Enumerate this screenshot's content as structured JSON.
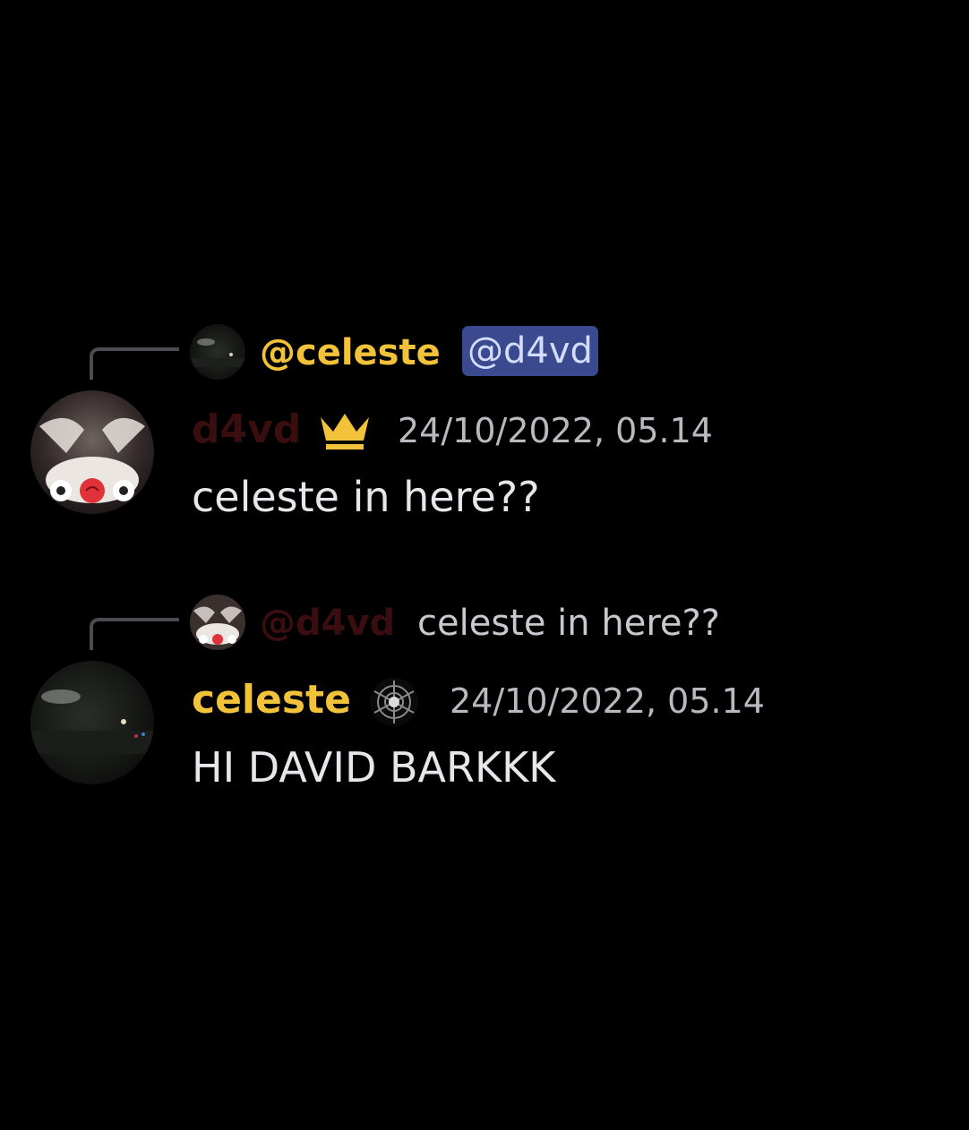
{
  "messages": [
    {
      "reply": {
        "author": "@celeste",
        "mention": "@d4vd"
      },
      "author": "d4vd",
      "role_icon": "crown-icon",
      "timestamp": "24/10/2022, 05.14",
      "content": "celeste in here??"
    },
    {
      "reply": {
        "author": "@d4vd",
        "text": "celeste in here??"
      },
      "author": "celeste",
      "role_icon": "spider-badge-icon",
      "timestamp": "24/10/2022, 05.14",
      "content": "HI DAVID BARKKK"
    }
  ],
  "colors": {
    "background": "#000000",
    "gold_name": "#f2c33a",
    "dark_red_name": "#3a0d0f",
    "mention_bg": "#3b4a8f",
    "timestamp": "#b8bac0",
    "text": "#e6e7ea"
  }
}
